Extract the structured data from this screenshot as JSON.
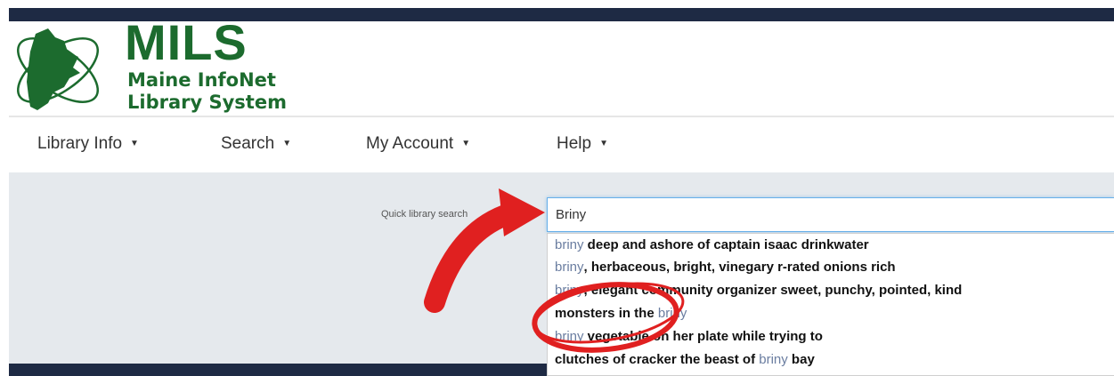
{
  "brand": {
    "logo_big": "MILS",
    "logo_line1": "Maine InfoNet",
    "logo_line2": "Library System",
    "color": "#1c6b2e"
  },
  "nav": {
    "items": [
      {
        "label": "Library Info"
      },
      {
        "label": "Search"
      },
      {
        "label": "My Account"
      },
      {
        "label": "Help"
      }
    ]
  },
  "search": {
    "label": "Quick library search",
    "value": "Briny"
  },
  "suggestions": [
    {
      "pre": "",
      "match": "briny",
      "post": " deep and ashore of captain isaac drinkwater"
    },
    {
      "pre": "",
      "match": "briny",
      "post": ", herbaceous, bright, vinegary r-rated onions rich"
    },
    {
      "pre": "",
      "match": "briny",
      "post": ", elegant community organizer sweet, punchy, pointed, kind"
    },
    {
      "pre": "monsters in the ",
      "match": "briny",
      "post": ""
    },
    {
      "pre": "",
      "match": "briny",
      "post": " vegetable on her plate while trying to"
    },
    {
      "pre": "clutches of cracker the beast of ",
      "match": "briny",
      "post": " bay"
    }
  ],
  "colors": {
    "navy": "#1e2a44",
    "band": "#e5e9ed",
    "highlight": "#6a7da0",
    "annotation_red": "#e02020"
  }
}
